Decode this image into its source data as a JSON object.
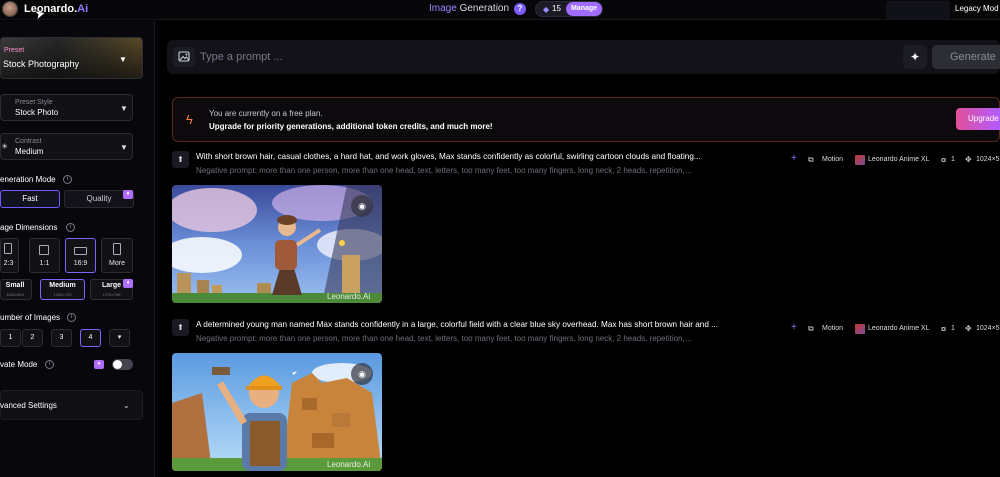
{
  "topbar": {
    "brand_name": "Leonardo.",
    "brand_suffix": "Ai",
    "title_accent": "Image",
    "title_rest": " Generation",
    "help_icon": "?",
    "token_count": "15",
    "manage_label": "Manage",
    "legacy_label": "Legacy Mod"
  },
  "sidebar": {
    "preset_label": "Preset",
    "preset_value": "Stock Photography",
    "preset_style_label": "Preset Style",
    "preset_style_value": "Stock Photo",
    "contrast_label": "Contrast",
    "contrast_value": "Medium",
    "generation_mode_title": "eneration Mode",
    "mode_fast": "Fast",
    "mode_quality": "Quality",
    "image_dimensions_title": "age Dimensions",
    "dimension_options": [
      "2:3",
      "1:1",
      "16:9",
      "More"
    ],
    "sizes": [
      {
        "name": "Small",
        "dims": "1184×664"
      },
      {
        "name": "Medium",
        "dims": "1280×720"
      },
      {
        "name": "Large",
        "dims": "1376×768"
      }
    ],
    "number_of_images_title": "umber of Images",
    "image_counts": [
      "1",
      "2",
      "3",
      "4"
    ],
    "private_mode_label": "vate Mode",
    "advanced_settings_label": "vanced Settings"
  },
  "main": {
    "prompt_placeholder": "Type a prompt ...",
    "generate_label": "Generate",
    "banner_line1": "You are currently on a free plan.",
    "banner_line2": "Upgrade for priority generations, additional token credits, and much more!",
    "upgrade_label": "Upgrade",
    "generations": [
      {
        "prompt": "With short brown hair, casual clothes, a hard hat, and work gloves, Max stands confidently as colorful, swirling cartoon clouds and floating...",
        "negative": "Negative prompt: more than one person, more than one head, text, letters, too many feet, too many fingers, long neck, 2 heads, repetition,...",
        "motion": "Motion",
        "model": "Leonardo Anime XL",
        "count": "1",
        "size": "1024×5",
        "watermark": "Leonardo.Ai"
      },
      {
        "prompt": "A determined young man named Max stands confidently in a large, colorful field with a clear blue sky overhead. Max has short brown hair and ...",
        "negative": "Negative prompt: more than one person, more than one head, text, letters, too many feet, too many fingers, long neck, 2 heads, repetition,...",
        "motion": "Motion",
        "model": "Leonardo Anime XL",
        "count": "1",
        "size": "1024×5",
        "watermark": "Leonardo.Ai"
      }
    ]
  },
  "colors": {
    "accent": "#8f7bff",
    "manage_badge": "#a06cff",
    "upgrade_gradient_start": "#e0509a",
    "banner_border": "#5a2a1c"
  },
  "icons": [
    "avatar",
    "cursor-icon",
    "help-icon",
    "token-icon",
    "chevron-down-icon",
    "sun-icon",
    "info-icon",
    "premium-icon",
    "image-icon",
    "sparkle-icon",
    "bolt-icon",
    "arrow-up-icon",
    "plus-icon",
    "motion-icon",
    "count-icon",
    "size-icon",
    "eye-icon"
  ]
}
